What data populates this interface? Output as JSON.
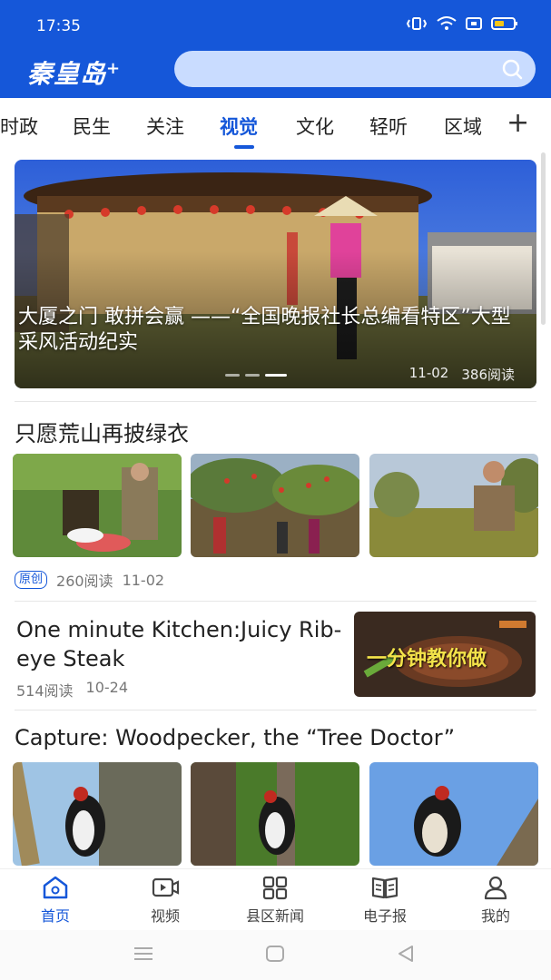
{
  "status": {
    "time": "17:35"
  },
  "header": {
    "logo": "秦皇岛",
    "logo_suffix": "+"
  },
  "tabs": [
    {
      "label": "时政"
    },
    {
      "label": "民生"
    },
    {
      "label": "关注"
    },
    {
      "label": "视觉"
    },
    {
      "label": "文化"
    },
    {
      "label": "轻听"
    },
    {
      "label": "区域"
    }
  ],
  "tab_more": "+",
  "banner": {
    "title": "大厦之门 敢拼会赢 ——“全国晚报社长总编看特区”大型采风活动纪实",
    "date": "11-02",
    "reads": "386阅读"
  },
  "article1": {
    "title": "只愿荒山再披绿衣",
    "badge": "原创",
    "reads": "260阅读",
    "date": "11-02"
  },
  "article2": {
    "title": "One minute Kitchen:Juicy Rib-eye Steak",
    "reads": "514阅读",
    "date": "10-24",
    "thumb_text": "一分钟教你做"
  },
  "article3": {
    "title": "Capture: Woodpecker, the “Tree Doctor”"
  },
  "bottom_nav": [
    {
      "label": "首页",
      "icon": "home-icon"
    },
    {
      "label": "视频",
      "icon": "video-icon"
    },
    {
      "label": "县区新闻",
      "icon": "grid-icon"
    },
    {
      "label": "电子报",
      "icon": "newspaper-icon"
    },
    {
      "label": "我的",
      "icon": "profile-icon"
    }
  ],
  "colors": {
    "brand": "#1557d9",
    "search_bg": "#c9dcff"
  }
}
